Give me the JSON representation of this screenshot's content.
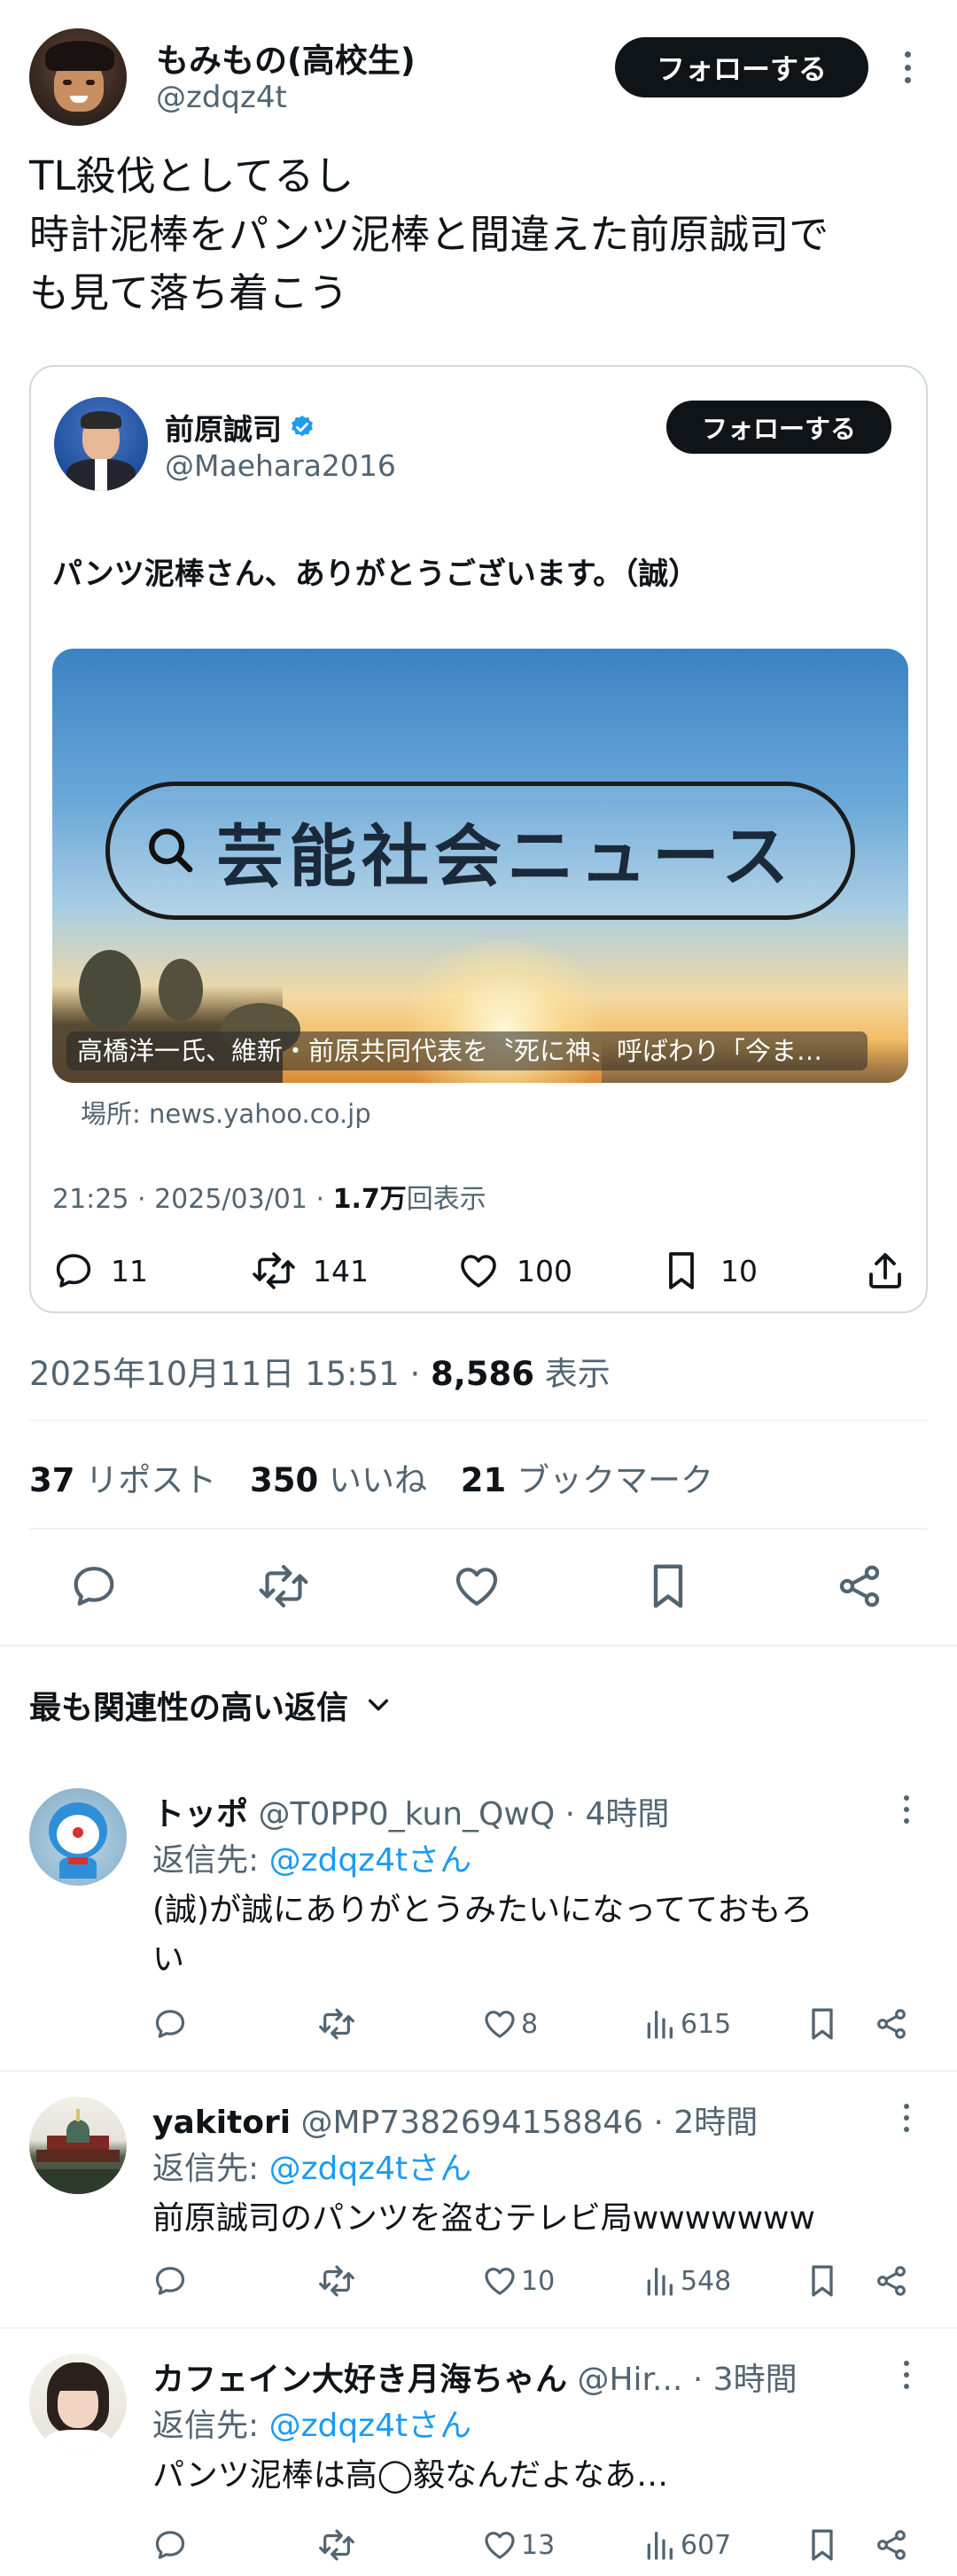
{
  "tweet": {
    "display_name": "もみもの(高校生)",
    "handle": "@zdqz4t",
    "follow_label": "フォローする",
    "text_line1": "TL殺伐としてるし",
    "text_line2": "時計泥棒をパンツ泥棒と間違えた前原誠司で",
    "text_line3": "も見て落ち着こう",
    "timestamp": "2025年10月11日 15:51 · ",
    "views_count": "8,586",
    "views_label": " 表示",
    "reposts_count": "37",
    "reposts_label": "リポスト",
    "likes_count": "350",
    "likes_label": "いいね",
    "bookmarks_count": "21",
    "bookmarks_label": "ブックマーク"
  },
  "quoted": {
    "display_name": "前原誠司",
    "handle": "@Maehara2016",
    "follow_label": "フォローする",
    "text": "パンツ泥棒さん、ありがとうございます。（誠）",
    "card_search_text": "芸能社会ニュース",
    "card_headline": "高橋洋一氏、維新・前原共同代表を〝死に神〟呼ばわり「今ま…",
    "card_source": "場所: news.yahoo.co.jp",
    "meta_time": "21:25 · 2025/03/01 · ",
    "meta_views": "1.7万",
    "meta_views_label": "回表示",
    "replies": "11",
    "reposts": "141",
    "likes": "100",
    "bookmarks": "10"
  },
  "replies_header": {
    "label": "最も関連性の高い返信"
  },
  "replies": [
    {
      "name": "トッポ",
      "handle": "@T0PP0_kun_QwQ",
      "time": "· 4時間",
      "reply_to_prefix": "返信先: ",
      "reply_to": "@zdqz4tさん",
      "text_line1": "(誠)が誠にありがとうみたいになってておもろ",
      "text_line2": "い",
      "likes": "8",
      "views": "615"
    },
    {
      "name": "yakitori",
      "handle": "@MP7382694158846",
      "time": "· 2時間",
      "reply_to_prefix": "返信先: ",
      "reply_to": "@zdqz4tさん",
      "text_line1": "前原誠司のパンツを盗むテレビ局wwwwwww",
      "text_line2": "",
      "likes": "10",
      "views": "548"
    },
    {
      "name": "カフェイン大好き月海ちゃん",
      "handle": "@Hir...",
      "time": "· 3時間",
      "reply_to_prefix": "返信先: ",
      "reply_to": "@zdqz4tさん",
      "text_line1": "パンツ泥棒は高◯毅なんだよなあ…",
      "text_line2": "",
      "likes": "13",
      "views": "607"
    }
  ],
  "colors": {
    "text": "#0f1419",
    "secondary": "#536471",
    "link": "#1d9bf0",
    "verified": "#1d9bf0",
    "divider": "#eff3f4"
  },
  "icons": [
    "reply-icon",
    "repost-icon",
    "like-icon",
    "bookmark-icon",
    "share-icon",
    "views-icon",
    "more-icon",
    "chevron-down-icon",
    "search-icon",
    "verified-badge-icon"
  ]
}
